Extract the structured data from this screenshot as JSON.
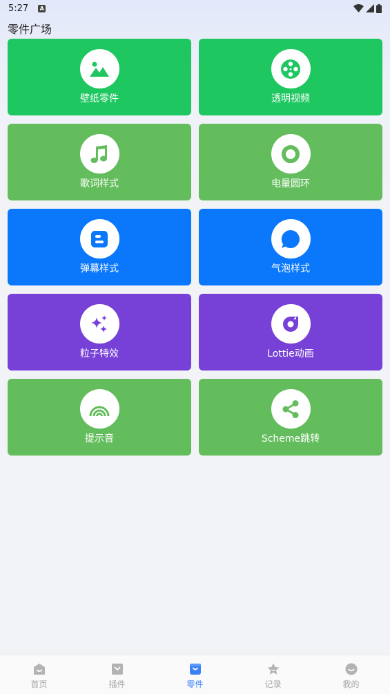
{
  "status_bar": {
    "time": "5:27",
    "notification_icon_letter": "A",
    "icons": [
      "wifi-icon",
      "signal-icon",
      "battery-icon"
    ]
  },
  "page": {
    "title": "零件广场"
  },
  "cards": [
    {
      "label": "壁纸零件",
      "icon": "image-icon",
      "color": "#1ec760"
    },
    {
      "label": "透明视频",
      "icon": "film-reel-icon",
      "color": "#1ec760"
    },
    {
      "label": "歌词样式",
      "icon": "music-note-icon",
      "color": "#64bd5c"
    },
    {
      "label": "电量圆环",
      "icon": "ring-icon",
      "color": "#64bd5c"
    },
    {
      "label": "弹幕样式",
      "icon": "blogger-icon",
      "color": "#0b78fb"
    },
    {
      "label": "气泡样式",
      "icon": "chat-bubble-icon",
      "color": "#0b78fb"
    },
    {
      "label": "粒子特效",
      "icon": "sparkles-icon",
      "color": "#7741d8"
    },
    {
      "label": "Lottie动画",
      "icon": "lottie-icon",
      "color": "#7741d8"
    },
    {
      "label": "提示音",
      "icon": "rainbow-icon",
      "color": "#64bd5c"
    },
    {
      "label": "Scheme跳转",
      "icon": "share-icon",
      "color": "#64bd5c"
    }
  ],
  "bottom_nav": {
    "items": [
      {
        "label": "首页",
        "icon": "home-icon"
      },
      {
        "label": "插件",
        "icon": "plugin-icon"
      },
      {
        "label": "零件",
        "icon": "bag-icon"
      },
      {
        "label": "记录",
        "icon": "star-icon"
      },
      {
        "label": "我的",
        "icon": "smile-icon"
      }
    ],
    "active_index": 2,
    "colors": {
      "active": "#3b82f6",
      "inactive": "#a5a5a5"
    }
  }
}
